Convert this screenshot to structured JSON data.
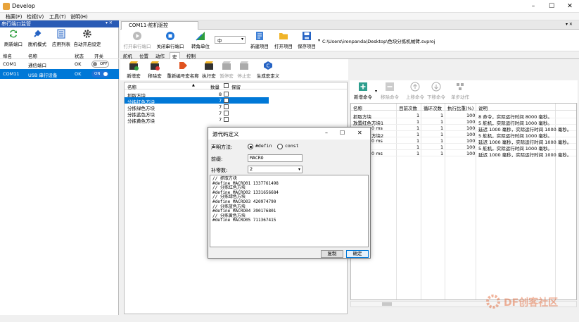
{
  "window": {
    "title": "Develop",
    "minimize": "–",
    "maximize": "☐",
    "close": "✕"
  },
  "menu": [
    "档案(F)",
    "检视(V)",
    "工具(T)",
    "说明(H)"
  ],
  "left_panel": {
    "title": "串行端口监管",
    "pin": "▾ ✕",
    "buttons": [
      "刷新端口",
      "脱机模式",
      "应用列表",
      "自动开启设定"
    ],
    "columns": [
      "埠名",
      "名称",
      "状态",
      "开关"
    ],
    "ports": [
      {
        "port": "COM1",
        "name": "通信端口",
        "status": "OK",
        "toggle": "OFF"
      },
      {
        "port": "COM11",
        "name": "USB 串行设备",
        "status": "OK",
        "toggle": "ON"
      }
    ]
  },
  "doc_tab": {
    "label": "COM11-舵机驱控",
    "controls": "▾ ✕"
  },
  "toolbar": {
    "buttons": [
      "打开串行端口",
      "关闭串行端口",
      "转角单位",
      "新建项目",
      "打开项目",
      "保存项目"
    ],
    "unit_value": "中",
    "path": "C:\\Users\\ironpanda\\Desktop\\色块分拣机械臂.svproj"
  },
  "subtabs": [
    "舵机",
    "位置",
    "动作",
    "宏",
    "控制"
  ],
  "macro_toolbar": [
    "新增宏",
    "移除宏",
    "重新编号宏名称",
    "执行宏",
    "暂停宏",
    "停止宏",
    "生成宏定义"
  ],
  "macro_table": {
    "columns": [
      "名称",
      "数量",
      "保留"
    ],
    "rows": [
      {
        "name": "抓取方块",
        "count": "8",
        "selected": false
      },
      {
        "name": "分拣红色方块",
        "count": "7",
        "selected": true
      },
      {
        "name": "分拣绿色方块",
        "count": "7",
        "selected": false
      },
      {
        "name": "分拣蓝色方块",
        "count": "7",
        "selected": false
      },
      {
        "name": "分拣黄色方块",
        "count": "7",
        "selected": false
      }
    ]
  },
  "command_toolbar": [
    "新增命令",
    "移除命令",
    "上移命令",
    "下移命令",
    "单步动作"
  ],
  "command_table": {
    "columns": [
      "名称",
      "目前次数",
      "循环次数",
      "执行比重(%)",
      "说明"
    ],
    "rows": [
      {
        "name": "抓取方块",
        "cur": "1",
        "loop": "1",
        "pct": "100",
        "desc": "8 命令，实际运行时间 8000 毫秒。"
      },
      {
        "name": "放置红色方块1",
        "cur": "1",
        "loop": "1",
        "pct": "100",
        "desc": "5 舵机，实际运行时间 1000 毫秒。"
      },
      {
        "name": "0 ms",
        "cur": "1",
        "loop": "1",
        "pct": "100",
        "desc": "延迟 1000 毫秒，实际运行时间 1000 毫秒。"
      },
      {
        "name": "方块2",
        "cur": "1",
        "loop": "1",
        "pct": "100",
        "desc": "5 舵机，实际运行时间 1000 毫秒。"
      },
      {
        "name": "0 ms",
        "cur": "1",
        "loop": "1",
        "pct": "100",
        "desc": "延迟 1000 毫秒，实际运行时间 1000 毫秒。"
      },
      {
        "name": "",
        "cur": "1",
        "loop": "1",
        "pct": "100",
        "desc": "5 舵机，实际运行时间 1000 毫秒。"
      },
      {
        "name": "0 ms",
        "cur": "1",
        "loop": "1",
        "pct": "100",
        "desc": "延迟 1000 毫秒，实际运行时间 1000 毫秒。"
      }
    ]
  },
  "dialog": {
    "title": "源代码定义",
    "decl_label": "声明方法:",
    "option_define": "#defin",
    "option_const": "const",
    "prefix_label": "前缀:",
    "prefix_value": "MACRO",
    "pad_label": "补零数:",
    "pad_value": "2",
    "code": "// 抓取方块\n#define MACRO01 1337761498\n// 分拣红色方块\n#define MACRO02 1331656684\n// 分拣绿色方块\n#define MACRO03 420974790\n// 分拣蓝色方块\n#define MACRO04 390176801\n// 分拣黄色方块\n#define MACRO05 711367415",
    "copy_button": "复制",
    "ok_button": "确定"
  },
  "watermark": "DF创客社区",
  "colors": {
    "accent": "#2a5bb5",
    "selection": "#0078d7"
  }
}
